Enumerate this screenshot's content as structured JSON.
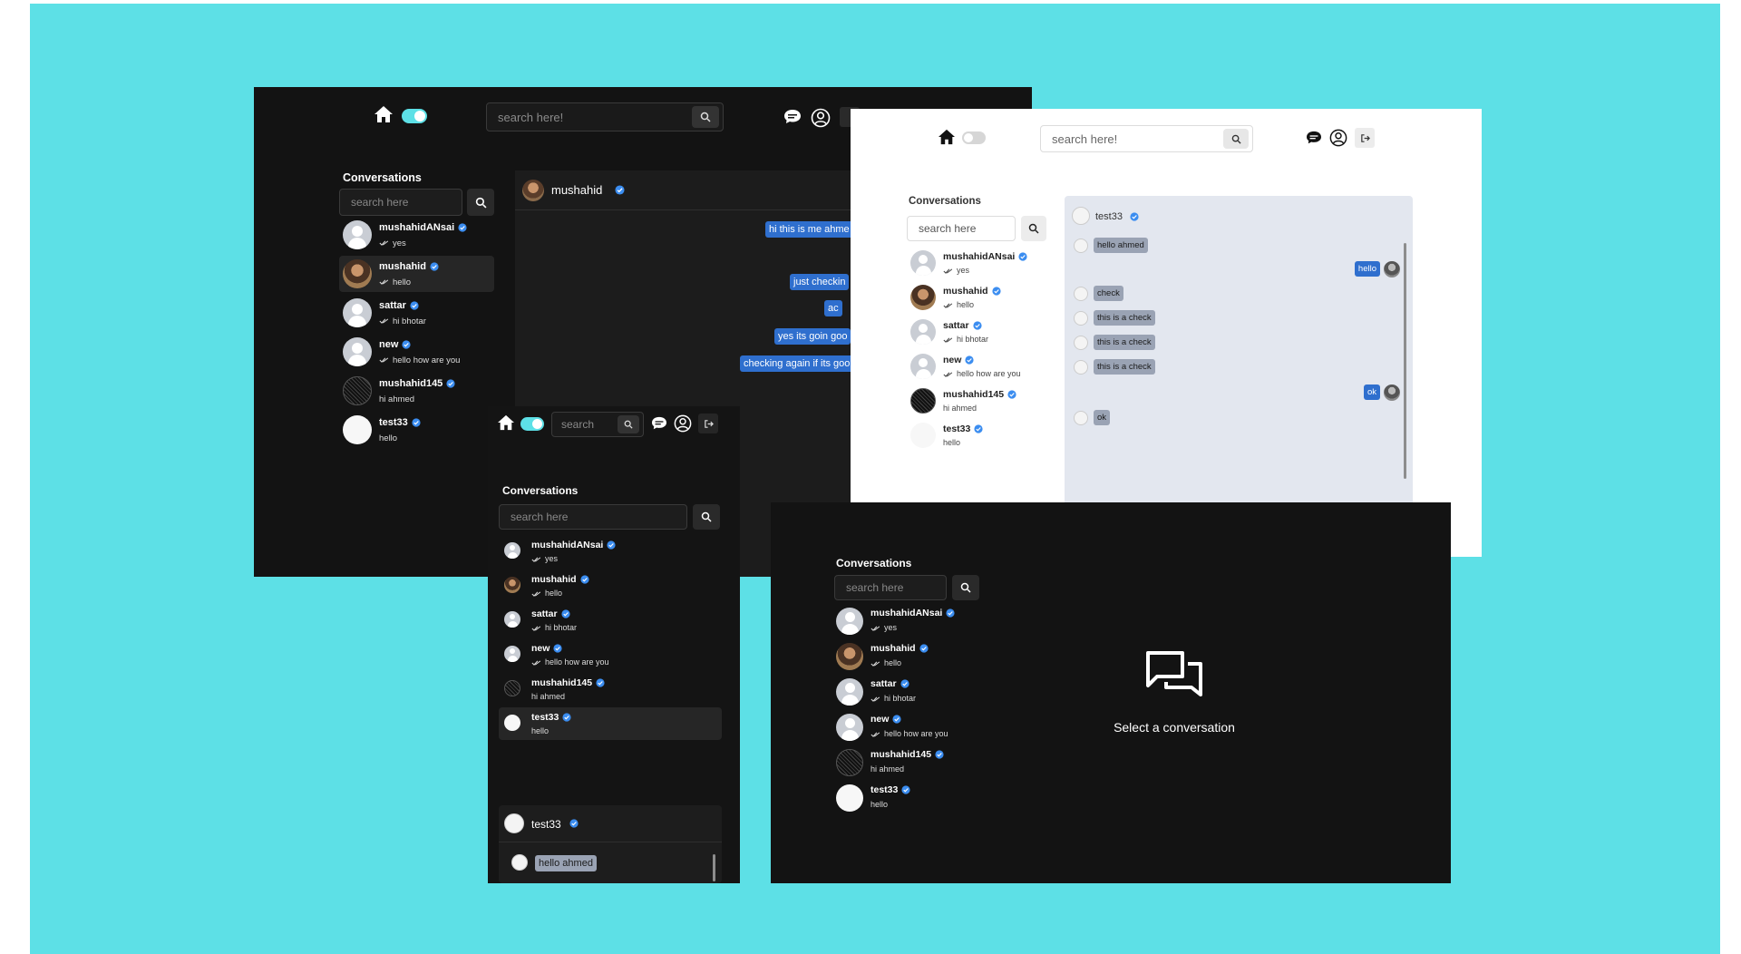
{
  "search_placeholder": "search here!",
  "search_small": "search",
  "conversations_label": "Conversations",
  "conv_search_placeholder": "search here",
  "conversations": [
    {
      "name": "mushahidANsai",
      "last": "yes",
      "check": true,
      "avatar": "default"
    },
    {
      "name": "mushahid",
      "last": "hello",
      "check": true,
      "avatar": "photo"
    },
    {
      "name": "sattar",
      "last": "hi bhotar",
      "check": true,
      "avatar": "default"
    },
    {
      "name": "new",
      "last": "hello how are you",
      "check": true,
      "avatar": "default"
    },
    {
      "name": "mushahid145",
      "last": "hi ahmed",
      "check": false,
      "avatar": "dark"
    },
    {
      "name": "test33",
      "last": "hello",
      "check": false,
      "avatar": "sketch"
    }
  ],
  "chat1": {
    "header": "mushahid",
    "messages": [
      "hi this is me ahme",
      "just checkin",
      "ac",
      "yes its goin goo",
      "checking again if its goo"
    ]
  },
  "chat_light": {
    "header": "test33",
    "messages": [
      {
        "text": "hello ahmed",
        "dir": "in"
      },
      {
        "text": "hello",
        "dir": "out"
      },
      {
        "text": "check",
        "dir": "in"
      },
      {
        "text": "this is a check",
        "dir": "in"
      },
      {
        "text": "this is a check",
        "dir": "in"
      },
      {
        "text": "this is a check",
        "dir": "in"
      },
      {
        "text": "ok",
        "dir": "out"
      },
      {
        "text": "ok",
        "dir": "in"
      }
    ]
  },
  "chat_mobile": {
    "header": "test33",
    "first": "hello ahmed"
  },
  "empty_state": "Select a conversation",
  "colors": {
    "background": "#5de0e6",
    "dark_panel": "#131313",
    "accent_blue": "#2f6fce",
    "verify_blue": "#3b8df0",
    "toggle_teal": "#5de0e6"
  }
}
